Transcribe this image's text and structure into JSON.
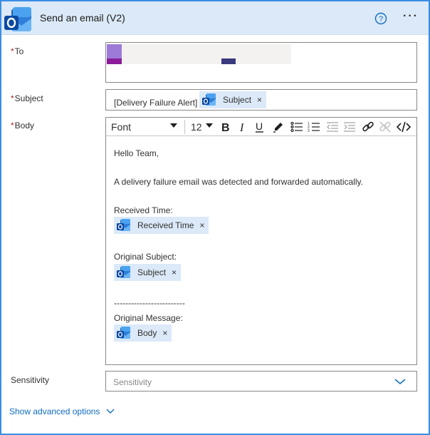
{
  "header": {
    "title": "Send an email (V2)",
    "help_icon": "question-circle-icon",
    "more_icon": "ellipsis-icon",
    "more_label": "···"
  },
  "fields": {
    "to": {
      "label": "To",
      "required_mark": "*"
    },
    "subject": {
      "label": "Subject",
      "required_mark": "*",
      "text": "[Delivery Failure Alert]",
      "token": {
        "label": "Subject",
        "remove": "×"
      }
    },
    "body": {
      "label": "Body",
      "required_mark": "*",
      "toolbar": {
        "font": "Font",
        "size": "12",
        "buttons": [
          "bold-icon",
          "italic-icon",
          "underline-icon",
          "highlight-pen-icon",
          "bullet-list-icon",
          "numbered-list-icon",
          "outdent-icon",
          "indent-icon",
          "link-icon",
          "unlink-icon",
          "code-view-icon"
        ]
      },
      "lines": {
        "greeting": "Hello Team,",
        "message": "A delivery failure email was detected and forwarded automatically.",
        "received_time_label": "Received Time:",
        "original_subject_label": "Original Subject:",
        "separator": "-------------------------",
        "original_message_label": "Original Message:"
      },
      "tokens": {
        "received_time": {
          "label": "Received Time",
          "remove": "×"
        },
        "subject": {
          "label": "Subject",
          "remove": "×"
        },
        "body": {
          "label": "Body",
          "remove": "×"
        }
      }
    },
    "sensitivity": {
      "label": "Sensitivity",
      "placeholder": "Sensitivity"
    }
  },
  "advanced": {
    "label": "Show advanced options"
  },
  "colors": {
    "accent": "#0f6cbd",
    "header_bg": "#dbe9f8",
    "border": "#3b8de3",
    "token_bg": "#dbe9f8",
    "required": "#a4262c"
  }
}
